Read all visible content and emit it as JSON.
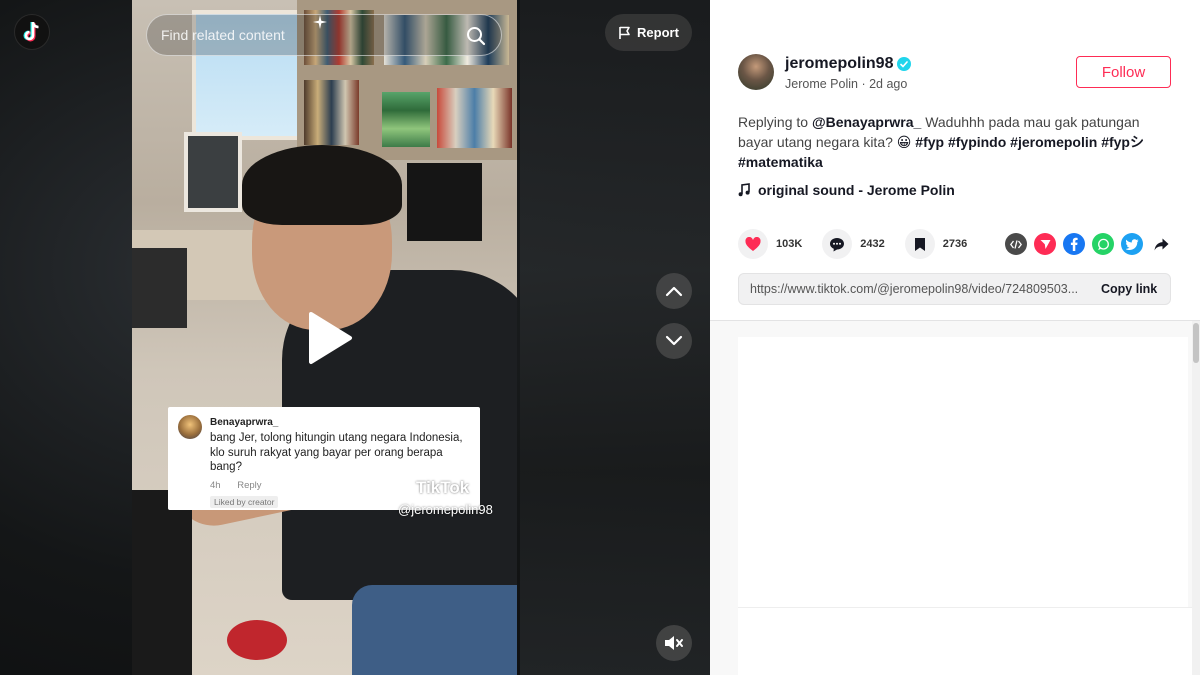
{
  "search": {
    "placeholder": "Find related content"
  },
  "player": {
    "report_label": "Report",
    "overlay_comment": {
      "username": "Benayaprwra_",
      "text": "bang Jer, tolong hitungin utang negara Indonesia, klo suruh rakyat yang bayar per orang berapa bang?",
      "time": "4h",
      "reply_label": "Reply",
      "liked_label": "Liked by creator"
    },
    "watermark": {
      "logo_text": "TikTok",
      "handle": "@jeromepolin98"
    }
  },
  "author": {
    "username": "jeromepolin98",
    "display_name": "Jerome Polin",
    "posted": "2d ago",
    "follow_label": "Follow"
  },
  "post": {
    "reply_prefix": "Replying to",
    "reply_to": "@Benayaprwra_",
    "caption": "Waduhhh pada mau gak patungan bayar utang negara kita?",
    "emoji": "😀",
    "hashtags": "#fyp #fypindo #jeromepolin #fypシ #matematika",
    "sound": "original sound - Jerome Polin"
  },
  "stats": {
    "likes": "103K",
    "comments": "2432",
    "saves": "2736"
  },
  "share_icons": [
    "embed-icon",
    "send-icon",
    "facebook-icon",
    "whatsapp-icon",
    "twitter-icon",
    "share-arrow-icon"
  ],
  "colors": {
    "brand_red": "#fe2c55",
    "verified": "#20d5ec",
    "like": "#fe2c55"
  },
  "link": {
    "url": "https://www.tiktok.com/@jeromepolin98/video/724809503...",
    "copy_label": "Copy link"
  }
}
